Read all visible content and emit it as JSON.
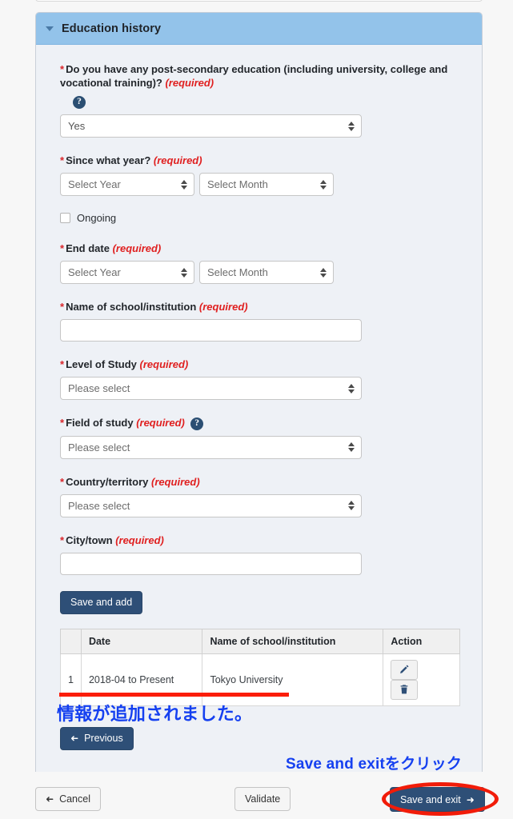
{
  "section": {
    "title": "Education history",
    "collapse_icon": "caret-down-icon"
  },
  "form": {
    "post_secondary": {
      "label": "Do you have any post-secondary education (including university, college and vocational training)?",
      "required_text": "(required)",
      "help_icon": "question-mark-icon",
      "value": "Yes"
    },
    "since_year": {
      "label": "Since what year?",
      "required_text": "(required)",
      "year_value": "Select Year",
      "month_value": "Select Month"
    },
    "ongoing": {
      "label": "Ongoing",
      "checked": false
    },
    "end_date": {
      "label": "End date",
      "required_text": "(required)",
      "year_value": "Select Year",
      "month_value": "Select Month"
    },
    "school_name": {
      "label": "Name of school/institution",
      "required_text": "(required)",
      "value": ""
    },
    "level_of_study": {
      "label": "Level of Study",
      "required_text": "(required)",
      "value": "Please select"
    },
    "field_of_study": {
      "label": "Field of study",
      "required_text": "(required)",
      "help_icon": "question-mark-icon",
      "value": "Please select"
    },
    "country": {
      "label": "Country/territory",
      "required_text": "(required)",
      "value": "Please select"
    },
    "city": {
      "label": "City/town",
      "required_text": "(required)",
      "value": ""
    },
    "save_and_add_label": "Save and add"
  },
  "table": {
    "columns": [
      "",
      "Date",
      "Name of school/institution",
      "Action"
    ],
    "rows": [
      {
        "index": "1",
        "date": "2018-04 to Present",
        "school": "Tokyo University",
        "edit_icon": "pencil-icon",
        "delete_icon": "trash-icon"
      }
    ]
  },
  "navigation": {
    "previous_label": "Previous",
    "previous_arrow": "arrow-left-icon"
  },
  "footer": {
    "cancel_label": "Cancel",
    "cancel_arrow": "arrow-left-icon",
    "validate_label": "Validate",
    "save_exit_label": "Save and exit",
    "save_exit_arrow": "arrow-right-icon"
  },
  "annotations": {
    "added_text": "情報が追加されました。",
    "click_text": "Save and exitをクリック",
    "annotation_color": "#1540f0",
    "highlight_color": "#fb1e0a"
  },
  "colors": {
    "header_blue": "#93c3ea",
    "panel_bg": "#eef1f6",
    "primary_button": "#2e4f77",
    "required_red": "#e02020"
  }
}
